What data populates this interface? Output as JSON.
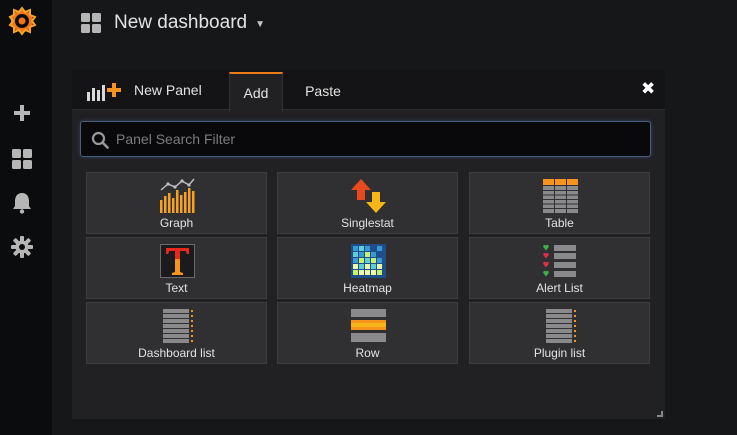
{
  "sidebar": {
    "logo": "grafana-logo",
    "items": [
      {
        "name": "plus-icon"
      },
      {
        "name": "dashboards-icon"
      },
      {
        "name": "bell-icon"
      },
      {
        "name": "gear-icon"
      }
    ]
  },
  "dashboard": {
    "title": "New dashboard"
  },
  "panel_editor": {
    "title": "New Panel",
    "tabs": [
      "Add",
      "Paste"
    ],
    "active_tab": "Add",
    "close": "✖",
    "search_placeholder": "Panel Search Filter",
    "search_value": "",
    "panels": [
      {
        "label": "Graph",
        "icon": "graph-icon"
      },
      {
        "label": "Singlestat",
        "icon": "singlestat-icon"
      },
      {
        "label": "Table",
        "icon": "table-icon"
      },
      {
        "label": "Text",
        "icon": "text-icon"
      },
      {
        "label": "Heatmap",
        "icon": "heatmap-icon"
      },
      {
        "label": "Alert List",
        "icon": "alert-list-icon"
      },
      {
        "label": "Dashboard list",
        "icon": "dashboard-list-icon"
      },
      {
        "label": "Row",
        "icon": "row-icon"
      },
      {
        "label": "Plugin list",
        "icon": "plugin-list-icon"
      }
    ]
  },
  "colors": {
    "accent": "#eb7b18",
    "background": "#161719",
    "sidebar": "#0b0c0e",
    "panel": "#212124",
    "tile": "#303033"
  }
}
